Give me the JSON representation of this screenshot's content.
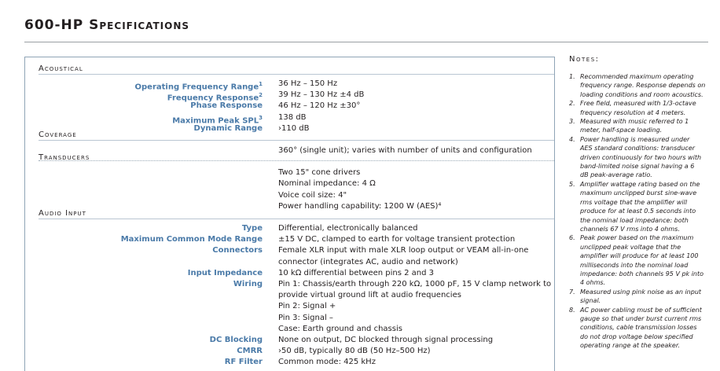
{
  "title": "600-HP Specifications",
  "sections": {
    "acoustical": "Acoustical",
    "coverage": "Coverage",
    "transducers": "Transducers",
    "audio_input": "Audio Input"
  },
  "acoustical": [
    {
      "label": "Operating Frequency Range",
      "sup": "1",
      "value": "36 Hz – 150 Hz"
    },
    {
      "label": "Frequency Response",
      "sup": "2",
      "value": "39 Hz – 130 Hz ±4 dB"
    },
    {
      "label": "Phase Response",
      "sup": "",
      "value": "46 Hz – 120 Hz ±30°"
    },
    {
      "label": "Maximum Peak SPL",
      "sup": "3",
      "value": "138 dB"
    },
    {
      "label": "Dynamic Range",
      "sup": "",
      "value": "›110 dB"
    }
  ],
  "coverage": {
    "value": "360° (single unit); varies with number of units and configuration"
  },
  "transducers": [
    "Two 15\" cone drivers",
    "Nominal impedance: 4 Ω",
    "Voice coil size: 4\"",
    "Power handling capability: 1200 W (AES)⁴"
  ],
  "audio_input": [
    {
      "label": "Type",
      "value": "Differential, electronically balanced"
    },
    {
      "label": "Maximum Common Mode Range",
      "value": "±15 V DC, clamped to earth for voltage transient protection"
    },
    {
      "label": "Connectors",
      "value": "Female XLR input with male XLR loop output or VEAM all-in-one"
    },
    {
      "label": "",
      "value": "connector (integrates AC, audio and network)"
    },
    {
      "label": "Input Impedance",
      "value": "10 kΩ differential between pins 2 and 3"
    },
    {
      "label": "Wiring",
      "value": "Pin 1: Chassis/earth through 220 kΩ, 1000 pF, 15 V clamp network to"
    },
    {
      "label": "",
      "value": "provide virtual ground lift at audio frequencies"
    },
    {
      "label": "",
      "value": "Pin 2: Signal +"
    },
    {
      "label": "",
      "value": "Pin 3: Signal –"
    },
    {
      "label": "",
      "value": "Case: Earth ground and chassis"
    },
    {
      "label": "DC Blocking",
      "value": "None on output, DC blocked through signal processing"
    },
    {
      "label": "CMRR",
      "value": "›50 dB, typically 80 dB (50 Hz–500 Hz)"
    },
    {
      "label": "RF Filter",
      "value": "Common mode: 425 kHz"
    }
  ],
  "notes_title": "Notes:",
  "notes": [
    {
      "num": "1.",
      "lines": [
        "Recommended maximum operating",
        "frequency range. Response depends on",
        "loading conditions and room acoustics."
      ]
    },
    {
      "num": "2.",
      "lines": [
        "Free field, measured with 1/3-octave",
        "frequency resolution at 4 meters."
      ]
    },
    {
      "num": "3.",
      "lines": [
        "Measured with music referred to 1",
        "meter, half-space loading."
      ]
    },
    {
      "num": "4.",
      "lines": [
        "Power handling is measured under",
        "AES standard conditions: transducer",
        "driven continuously for two hours with",
        "band-limited noise signal having a 6",
        "dB peak-average ratio."
      ]
    },
    {
      "num": "5.",
      "lines": [
        "Amplifier wattage rating based on the",
        "maximum unclipped burst sine-wave",
        "rms voltage that the amplifier will",
        "produce for at least 0.5 seconds into",
        "the nominal load impedance: both",
        "channels 67 V rms into 4 ohms."
      ]
    },
    {
      "num": "6.",
      "lines": [
        "Peak power based on the maximum",
        "unclipped peak voltage that the",
        "amplifier will produce for at least 100",
        "milliseconds into the nominal load",
        "impedance: both channels 95 V pk into",
        "4 ohms."
      ]
    },
    {
      "num": "7.",
      "lines": [
        "Measured using pink noise as an input",
        "signal."
      ]
    },
    {
      "num": "8.",
      "lines": [
        "AC power cabling must be of sufficient",
        "gauge so that under burst current rms",
        "conditions, cable transmission losses",
        "do not drop voltage below specified",
        "operating range at the speaker."
      ]
    }
  ]
}
